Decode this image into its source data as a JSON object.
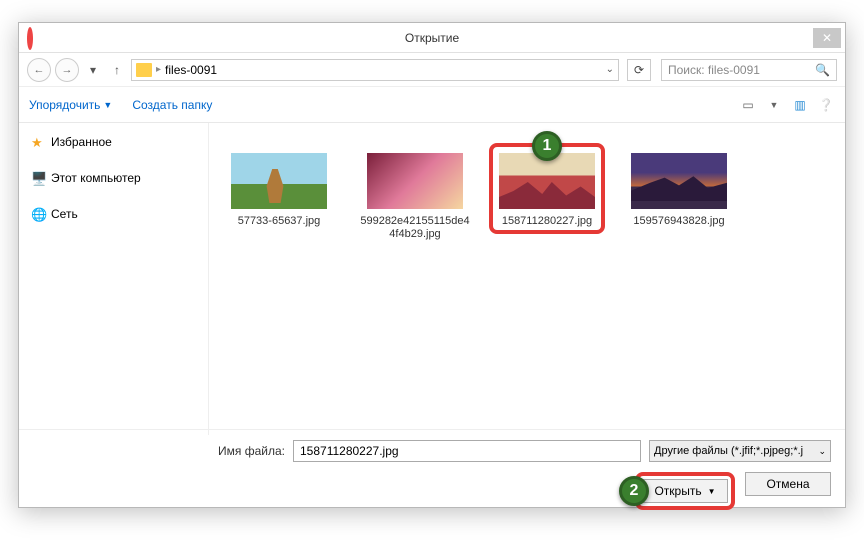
{
  "title": "Открытие",
  "nav": {
    "breadcrumb_folder": "files-0091",
    "search_placeholder": "Поиск: files-0091"
  },
  "toolbar": {
    "organize": "Упорядочить",
    "new_folder": "Создать папку"
  },
  "sidebar": {
    "favorites": "Избранное",
    "this_pc": "Этот компьютер",
    "network": "Сеть"
  },
  "files": [
    {
      "name": "57733-65637.jpg"
    },
    {
      "name": "599282e42155115de44f4b29.jpg"
    },
    {
      "name": "158711280227.jpg"
    },
    {
      "name": "159576943828.jpg"
    }
  ],
  "footer": {
    "filename_label": "Имя файла:",
    "filename_value": "158711280227.jpg",
    "filetype": "Другие файлы (*.jfif;*.pjpeg;*.j",
    "open": "Открыть",
    "cancel": "Отмена"
  },
  "markers": {
    "one": "1",
    "two": "2"
  }
}
